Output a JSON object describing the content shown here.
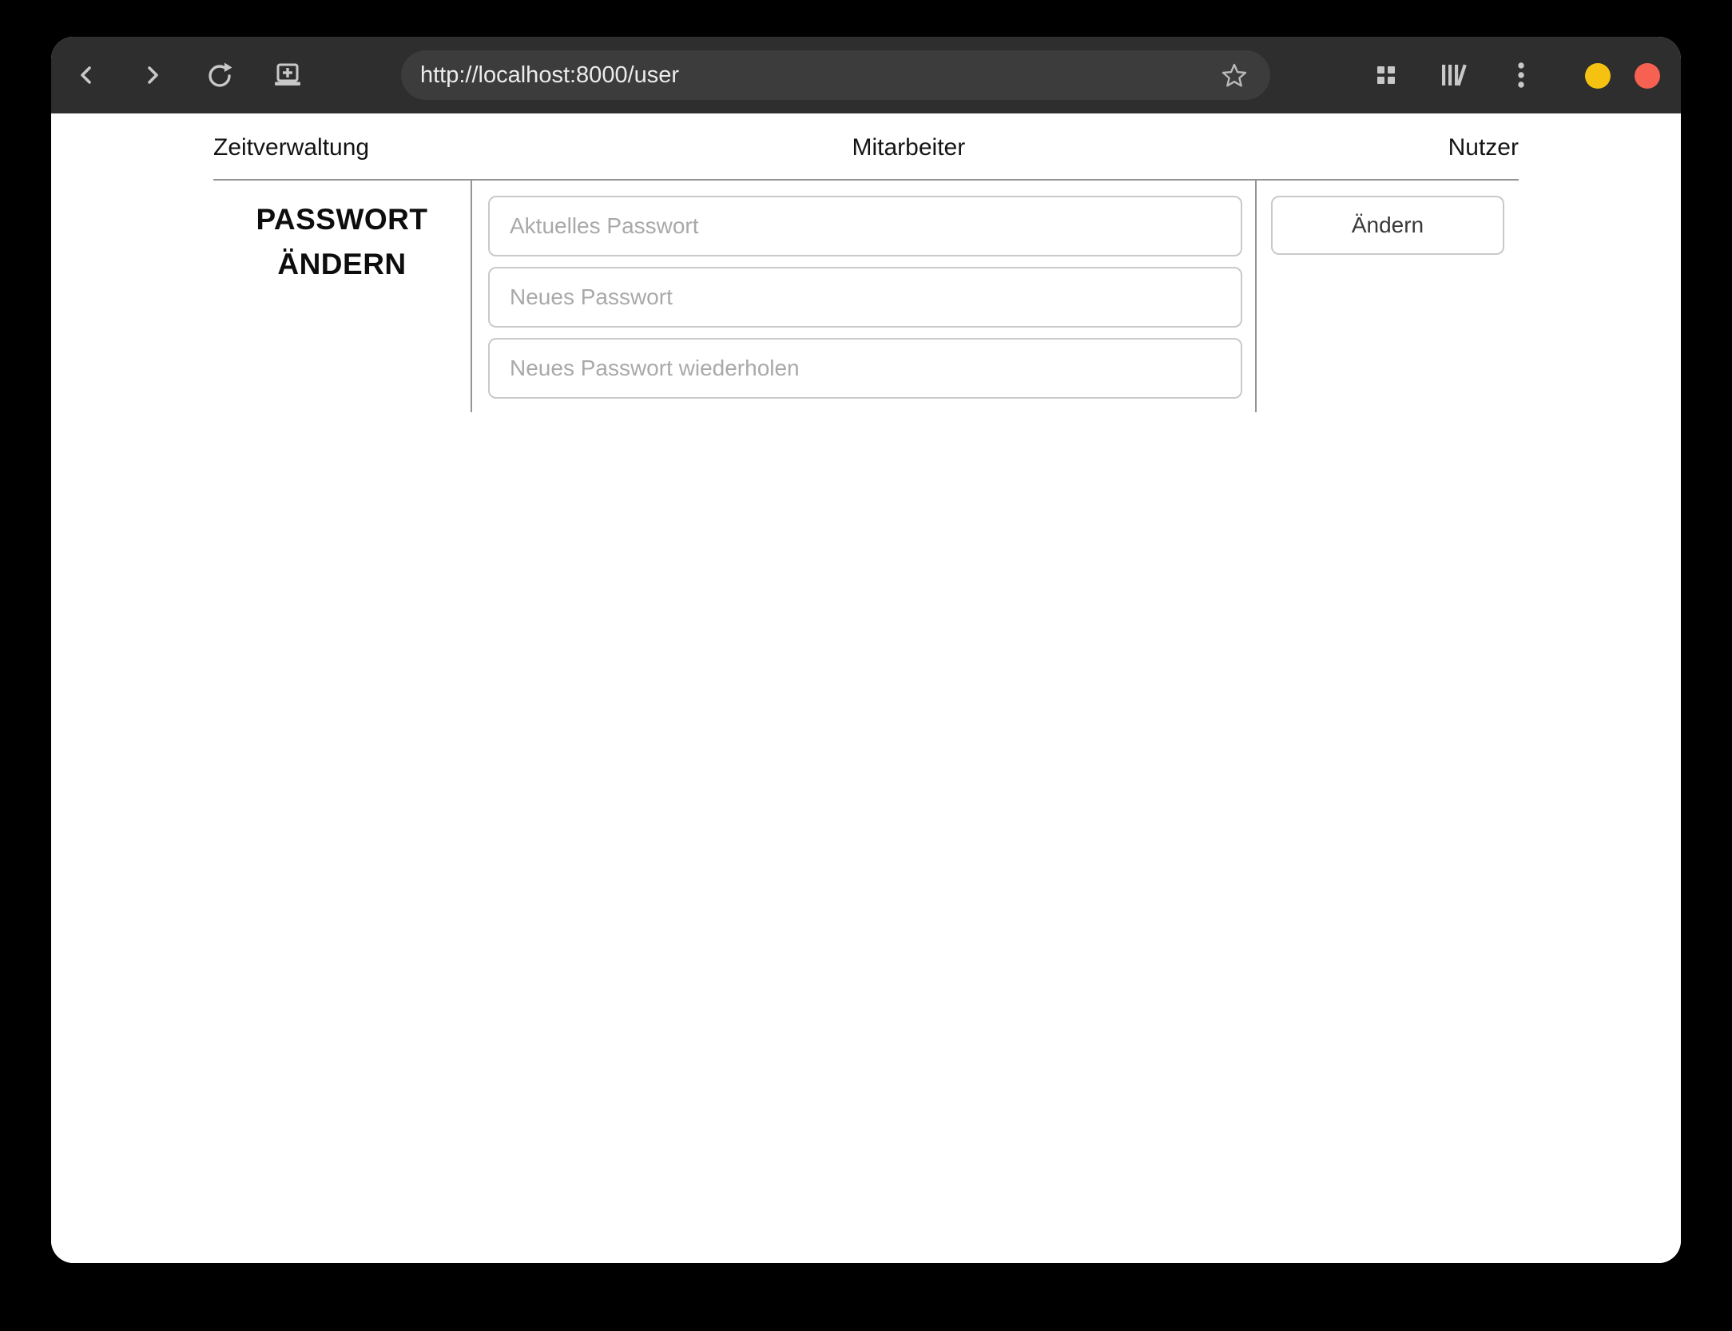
{
  "browser": {
    "url": "http://localhost:8000/user",
    "toolbar_icons": [
      "back-chevron",
      "forward-chevron",
      "reload-circular-arrow",
      "new-tab-screen-plus",
      "bookmark-star-outline",
      "tab-overview-grid",
      "library-books",
      "menu-kebab"
    ],
    "window_controls": [
      {
        "name": "minimize",
        "color": "#f5c211"
      },
      {
        "name": "close",
        "color": "#f66151"
      }
    ]
  },
  "nav": {
    "items": [
      {
        "label": "Zeitverwaltung"
      },
      {
        "label": "Mitarbeiter"
      },
      {
        "label": "Nutzer"
      }
    ]
  },
  "password_form": {
    "heading": "PASSWORT ÄNDERN",
    "fields": [
      {
        "placeholder": "Aktuelles Passwort"
      },
      {
        "placeholder": "Neues Passwort"
      },
      {
        "placeholder": "Neues Passwort wiederholen"
      }
    ],
    "submit_label": "Ändern"
  },
  "colors": {
    "titlebar": "#2e2e2e",
    "urlbar": "#3c3c3c",
    "page_background": "#ffffff",
    "outer_background": "#000000",
    "divider": "#949494",
    "input_border": "#c9c9c9",
    "placeholder_text": "#a9a9a9",
    "minimize_button": "#f5c211",
    "close_button": "#f66151"
  }
}
